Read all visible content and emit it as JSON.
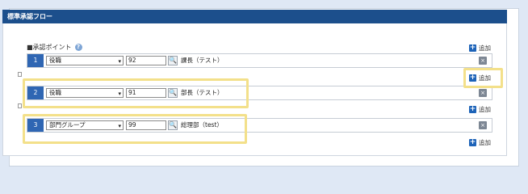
{
  "panel": {
    "title": "標準承認フロー"
  },
  "section": {
    "label": "■承認ポイント",
    "help_icon": "question-circle-icon"
  },
  "add_label": "追加",
  "delete_glyph": "×",
  "search_glyph": "🔍",
  "caret_glyph": "▾",
  "help_glyph": "?",
  "plus_glyph": "+",
  "rows": [
    {
      "num": "1",
      "type": "役職",
      "code": "92",
      "name": "課長（テスト）"
    },
    {
      "num": "2",
      "type": "役職",
      "code": "91",
      "name": "部長（テスト）"
    },
    {
      "num": "3",
      "type": "部門グループ",
      "code": "99",
      "name": "総理部（test）"
    }
  ],
  "colors": {
    "header": "#1c4f8c",
    "row_num": "#2f66b3",
    "highlight": "#f3e08a"
  }
}
